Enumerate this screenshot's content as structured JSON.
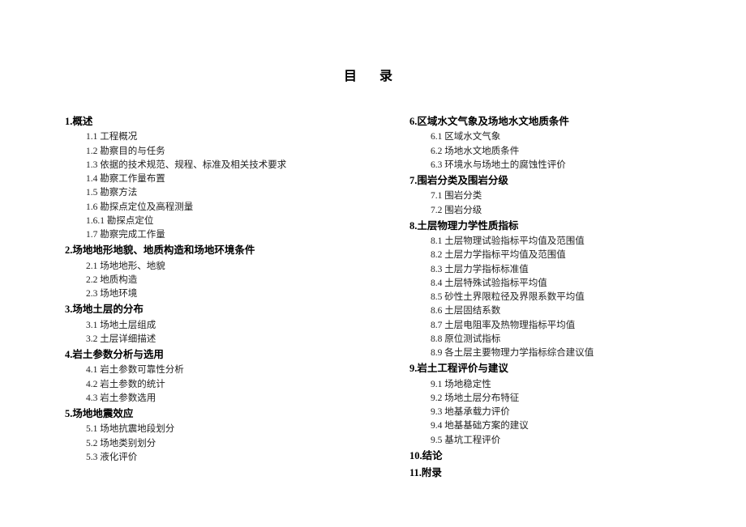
{
  "title": "目 录",
  "left": [
    {
      "type": "section",
      "text": "1.概述"
    },
    {
      "type": "item",
      "text": "1.1 工程概况"
    },
    {
      "type": "item",
      "text": "1.2 勘察目的与任务"
    },
    {
      "type": "item",
      "text": "1.3 依据的技术规范、规程、标准及相关技术要求"
    },
    {
      "type": "item",
      "text": "1.4 勘察工作量布置"
    },
    {
      "type": "item",
      "text": "1.5 勘察方法"
    },
    {
      "type": "item",
      "text": "1.6 勘探点定位及高程测量"
    },
    {
      "type": "item",
      "text": "1.6.1 勘探点定位"
    },
    {
      "type": "item",
      "text": "1.7 勘察完成工作量"
    },
    {
      "type": "section",
      "text": "2.场地地形地貌、地质构造和场地环境条件"
    },
    {
      "type": "item",
      "text": "2.1 场地地形、地貌"
    },
    {
      "type": "item",
      "text": "2.2 地质构造"
    },
    {
      "type": "item",
      "text": "2.3 场地环境"
    },
    {
      "type": "section",
      "text": "3.场地土层的分布"
    },
    {
      "type": "item",
      "text": "3.1 场地土层组成"
    },
    {
      "type": "item",
      "text": "3.2 土层详细描述"
    },
    {
      "type": "section",
      "text": "4.岩土参数分析与选用"
    },
    {
      "type": "item",
      "text": "4.1 岩土参数可靠性分析"
    },
    {
      "type": "item",
      "text": "4.2 岩土参数的统计"
    },
    {
      "type": "item",
      "text": "4.3 岩土参数选用"
    },
    {
      "type": "section",
      "text": "5.场地地震效应"
    },
    {
      "type": "item",
      "text": "5.1 场地抗震地段划分"
    },
    {
      "type": "item",
      "text": "5.2 场地类别划分"
    },
    {
      "type": "item",
      "text": "5.3 液化评价"
    }
  ],
  "right": [
    {
      "type": "section",
      "text": "6.区域水文气象及场地水文地质条件"
    },
    {
      "type": "item",
      "text": "6.1 区域水文气象"
    },
    {
      "type": "item",
      "text": "6.2 场地水文地质条件"
    },
    {
      "type": "item",
      "text": "6.3 环境水与场地土的腐蚀性评价"
    },
    {
      "type": "section",
      "text": "7.围岩分类及围岩分级"
    },
    {
      "type": "item",
      "text": "7.1 围岩分类"
    },
    {
      "type": "item",
      "text": "7.2 围岩分级"
    },
    {
      "type": "section",
      "text": "8.土层物理力学性质指标"
    },
    {
      "type": "item",
      "text": "8.1 土层物理试验指标平均值及范围值"
    },
    {
      "type": "item",
      "text": "8.2 土层力学指标平均值及范围值"
    },
    {
      "type": "item",
      "text": "8.3 土层力学指标标准值"
    },
    {
      "type": "item",
      "text": "8.4 土层特殊试验指标平均值"
    },
    {
      "type": "item",
      "text": "8.5 砂性土界限粒径及界限系数平均值"
    },
    {
      "type": "item",
      "text": "8.6 土层固结系数"
    },
    {
      "type": "item",
      "text": "8.7 土层电阻率及热物理指标平均值"
    },
    {
      "type": "item",
      "text": "8.8 原位测试指标"
    },
    {
      "type": "item",
      "text": "8.9 各土层主要物理力学指标综合建议值"
    },
    {
      "type": "section",
      "text": "9.岩土工程评价与建议"
    },
    {
      "type": "item",
      "text": "9.1 场地稳定性"
    },
    {
      "type": "item",
      "text": "9.2 场地土层分布特征"
    },
    {
      "type": "item",
      "text": "9.3 地基承载力评价"
    },
    {
      "type": "item",
      "text": "9.4 地基基础方案的建议"
    },
    {
      "type": "item",
      "text": "9.5 基坑工程评价"
    },
    {
      "type": "section",
      "text": "10.结论"
    },
    {
      "type": "section",
      "text": "11.附录"
    }
  ]
}
